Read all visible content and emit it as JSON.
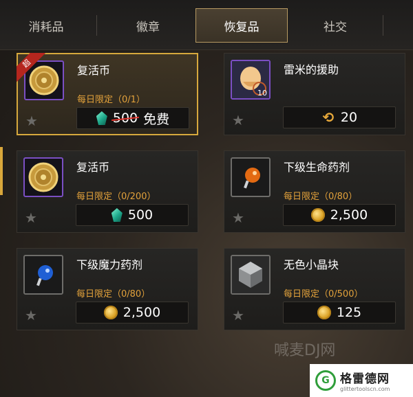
{
  "tabs": [
    {
      "label": "消耗品"
    },
    {
      "label": "徽章"
    },
    {
      "label": "恢复品"
    },
    {
      "label": "社交"
    }
  ],
  "cards": [
    {
      "name": "复活币",
      "limit": "每日限定（0/1）",
      "price_old": "500",
      "price_free": "免费",
      "ribbon": "超",
      "currency_icon": "gem-icon"
    },
    {
      "name": "雷米的援助",
      "badge": "10",
      "price": "20",
      "currency_icon": "sigil-icon"
    },
    {
      "name": "复活币",
      "limit": "每日限定（0/200）",
      "price": "500",
      "currency_icon": "gem-icon"
    },
    {
      "name": "下级生命药剂",
      "limit": "每日限定（0/80）",
      "price": "2,500",
      "currency_icon": "gold-coin-icon"
    },
    {
      "name": "下级魔力药剂",
      "limit": "每日限定（0/80）",
      "price": "2,500",
      "currency_icon": "gold-coin-icon"
    },
    {
      "name": "无色小晶块",
      "limit": "每日限定（0/500）",
      "price": "125",
      "currency_icon": "gold-coin-icon"
    }
  ],
  "watermark": {
    "text": "喊麦DJ网"
  },
  "brand": {
    "title": "格雷德网",
    "url": "glittertoolscn.com"
  }
}
